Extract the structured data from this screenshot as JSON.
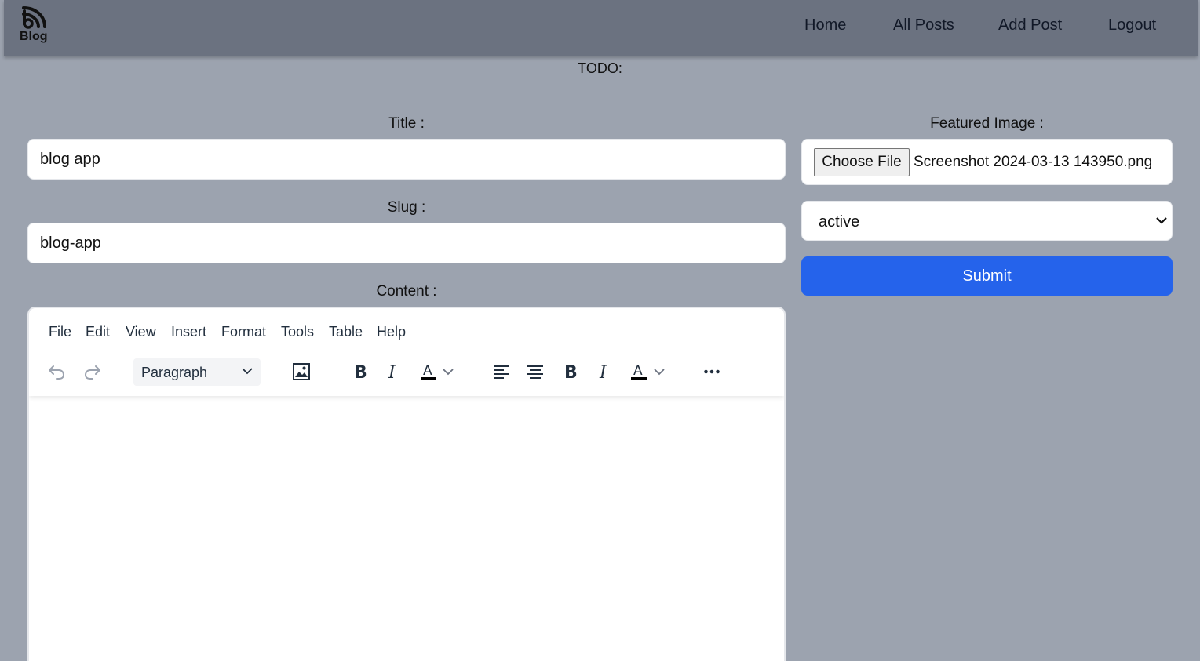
{
  "app": {
    "logo_text": "Blog",
    "logo_icon": "rss-icon"
  },
  "nav": {
    "items": [
      {
        "label": "Home"
      },
      {
        "label": "All Posts"
      },
      {
        "label": "Add Post"
      },
      {
        "label": "Logout"
      }
    ]
  },
  "page": {
    "todo_text": "TODO:"
  },
  "form": {
    "title_label": "Title :",
    "title_value": "blog app",
    "slug_label": "Slug :",
    "slug_value": "blog-app",
    "content_label": "Content :",
    "featured_label": "Featured Image :",
    "file_button": "Choose File",
    "file_name": "Screenshot 2024-03-13 143950.png",
    "status_value": "active",
    "status_options": [
      "active"
    ],
    "submit_label": "Submit"
  },
  "editor": {
    "menu": [
      "File",
      "Edit",
      "View",
      "Insert",
      "Format",
      "Tools",
      "Table",
      "Help"
    ],
    "block_format": "Paragraph",
    "toolbar_icons": [
      "undo-icon",
      "redo-icon",
      "image-icon",
      "bold-icon",
      "italic-icon",
      "text-color-icon",
      "align-left-icon",
      "align-center-icon",
      "bold-icon",
      "italic-icon",
      "text-color-icon",
      "more-icon"
    ],
    "text_color": "#000000"
  },
  "colors": {
    "page_bg": "#9ca3af",
    "navbar_bg": "#6b7280",
    "submit_bg": "#2563eb"
  }
}
